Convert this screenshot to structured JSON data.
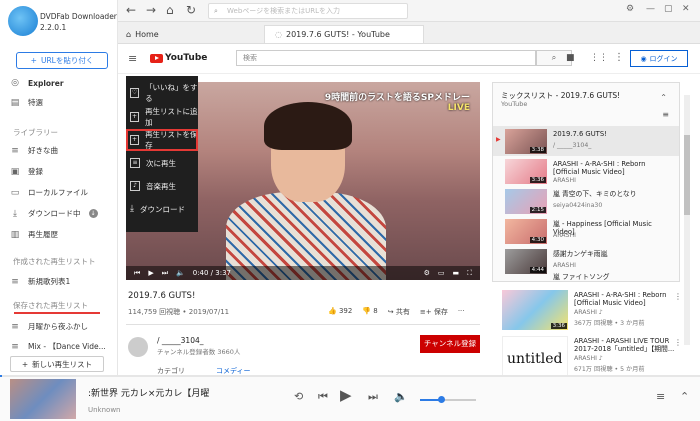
{
  "app": {
    "name": "DVDFab Downloader",
    "version": "2.2.0.1"
  },
  "sidebar": {
    "url_button": "URLを貼り付く",
    "explorer": "Explorer",
    "featured": "特選",
    "library_header": "ライブラリー",
    "library_items": [
      "好きな曲",
      "登録",
      "ローカルファイル",
      "ダウンロード中",
      "再生履歴"
    ],
    "created_header": "作成された再生リストト",
    "created_items": [
      "新規歌列表1"
    ],
    "saved_header": "保存された再生リスト",
    "saved_items": [
      "月曜から夜ふかし",
      "Mix - 【Dance Vide..."
    ],
    "new_playlist": "新しい再生リスト"
  },
  "topbar": {
    "address_placeholder": "Webページを検索またはURLを入力"
  },
  "tabs": [
    {
      "label": "Home"
    },
    {
      "label": "2019.7.6 GUTS! - YouTube"
    }
  ],
  "youtube": {
    "logo": "YouTube",
    "search_placeholder": "検索",
    "login": "ログイン"
  },
  "menu": {
    "items": [
      "「いいね」をする",
      "再生リストに追加",
      "再生リストを保存",
      "次に再生",
      "音楽再生",
      "ダウンロード"
    ]
  },
  "video": {
    "overlay_text": "9時間前のラストを語るSPメドレー",
    "overlay_live": "LIVE",
    "time": "0:40 / 3:37",
    "title": "2019.7.6 GUTS!",
    "meta": "114,759 回視聴 • 2019/07/11",
    "likes": "392",
    "dislikes": "8",
    "share": "共有",
    "save": "保存",
    "channel": "/ _____3104_",
    "subscribers": "チャンネル登録者数 3660人",
    "subscribe": "チャンネル登録",
    "category_label": "カテゴリ",
    "category_value": "コメディー"
  },
  "playlist": {
    "title": "ミックスリスト - 2019.7.6 GUTS!",
    "channel": "YouTube",
    "items": [
      {
        "title": "2019.7.6 GUTS!",
        "channel": "/ _____3104_",
        "duration": "3:38"
      },
      {
        "title": "ARASHI - A-RA-SHI : Reborn [Official Music Video]",
        "channel": "ARASHI",
        "duration": "3:36"
      },
      {
        "title": "嵐 青空の下、キミのとなり",
        "channel": "seiya0424ina30",
        "duration": "2:15"
      },
      {
        "title": "嵐 - Happiness [Official Music Video]",
        "channel": "ARASHI",
        "duration": "4:30"
      },
      {
        "title": "感謝カンゲキ雨嵐",
        "channel": "ARASHI",
        "duration": "4:44"
      },
      {
        "title": "嵐 ファイトソング",
        "channel": "",
        "duration": ""
      }
    ]
  },
  "recommended": [
    {
      "title": "ARASHI - A-RA-SHI : Reborn [Official Music Video]",
      "channel": "ARASHI ♪",
      "meta": "367万 回視聴 • 3 か月前",
      "duration": "3:36"
    },
    {
      "title": "ARASHI - ARASHI LIVE TOUR 2017-2018「untitled」【期間...",
      "channel": "ARASHI ♪",
      "meta": "671万 回視聴 • 5 か月前",
      "duration": "",
      "thumb_text": "untitled"
    }
  ],
  "player": {
    "title": ":新世界 元カレ×元カレ【月曜",
    "artist": "Unknown"
  }
}
